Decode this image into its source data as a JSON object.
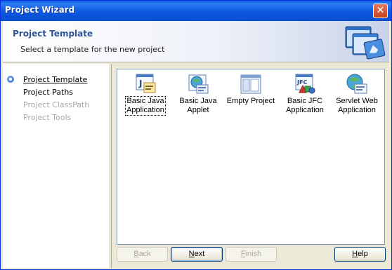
{
  "window": {
    "title": "Project Wizard",
    "close_symbol": "✕"
  },
  "header": {
    "title": "Project Template",
    "subtitle": "Select a template for the new project"
  },
  "sidebar": {
    "steps": [
      {
        "label": "Project Template",
        "state": "current"
      },
      {
        "label": "Project Paths",
        "state": "enabled"
      },
      {
        "label": "Project ClassPath",
        "state": "disabled"
      },
      {
        "label": "Project Tools",
        "state": "disabled"
      }
    ]
  },
  "templates": [
    {
      "line1": "Basic Java",
      "line2": "Application",
      "icon": "java-application-icon",
      "selected": true
    },
    {
      "line1": "Basic Java",
      "line2": "Applet",
      "icon": "java-applet-icon",
      "selected": false
    },
    {
      "line1": "Empty Project",
      "line2": "",
      "icon": "empty-project-icon",
      "selected": false
    },
    {
      "line1": "Basic JFC",
      "line2": "Application",
      "icon": "jfc-application-icon",
      "selected": false
    },
    {
      "line1": "Servlet Web",
      "line2": "Application",
      "icon": "servlet-web-icon",
      "selected": false
    }
  ],
  "buttons": {
    "back": {
      "pre": "",
      "mnemonic": "B",
      "post": "ack",
      "enabled": false
    },
    "next": {
      "pre": "",
      "mnemonic": "N",
      "post": "ext",
      "enabled": true
    },
    "finish": {
      "pre": "",
      "mnemonic": "F",
      "post": "inish",
      "enabled": false
    },
    "help": {
      "pre": "",
      "mnemonic": "H",
      "post": "elp",
      "enabled": true
    }
  },
  "icon_text": {
    "java": "J",
    "jfc": "JFC"
  },
  "colors": {
    "titlebar": "#0a58e0",
    "header_title": "#2e5396",
    "disabled_text": "#a9a9a9"
  }
}
